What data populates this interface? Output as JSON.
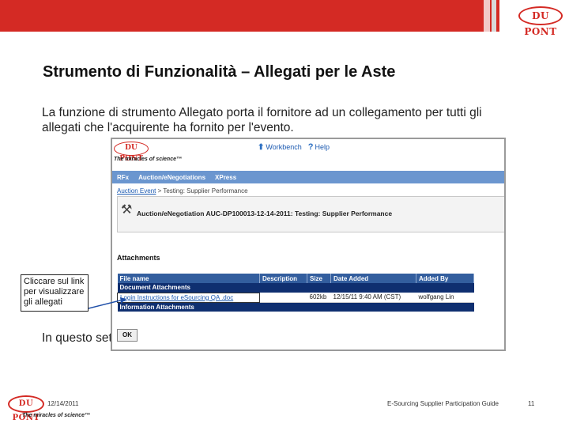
{
  "header": {
    "logo_text": "DU PONT"
  },
  "slide": {
    "title": "Strumento di Funzionalità – Allegati per le Aste",
    "intro": "La funzione di strumento Allegato porta il fornitore ad un collegamento per tutti gli allegati che l'acquirente ha fornito per l'evento.",
    "partial_text": "In questo set"
  },
  "callout": {
    "text": "Cliccare sul link per visualizzare gli allegati"
  },
  "app": {
    "logo_text": "DU PONT",
    "tagline": "The miracles of science™",
    "toplinks": {
      "workbench": "Workbench",
      "help": "Help"
    },
    "nav": [
      "RFx",
      "Auction/eNegotiations",
      "XPress"
    ],
    "breadcrumb": {
      "link": "Auction Event",
      "rest": "> Testing: Supplier Performance"
    },
    "event_title": "Auction/eNegotiation AUC-DP100013-12-14-2011: Testing: Supplier Performance",
    "attachments_heading": "Attachments",
    "table": {
      "headers": [
        "File name",
        "Description",
        "Size",
        "Date Added",
        "Added By"
      ],
      "group_document": "Document Attachments",
      "file": {
        "name": "Login Instructions for eSourcing QA .doc",
        "description": "",
        "size": "602kb",
        "date": "12/15/11 9:40 AM (CST)",
        "added_by": "wolfgang Lin"
      },
      "group_information": "Information Attachments"
    },
    "ok_label": "OK"
  },
  "footer": {
    "logo_text": "DU PONT",
    "tagline": "The miracles of science™",
    "date": "12/14/2011",
    "guide": "E-Sourcing Supplier Participation Guide",
    "page": "11"
  },
  "colors": {
    "brand_red": "#d42a24",
    "nav_blue": "#6b96cf",
    "table_header": "#335e9e",
    "group_row": "#0f2f70"
  }
}
